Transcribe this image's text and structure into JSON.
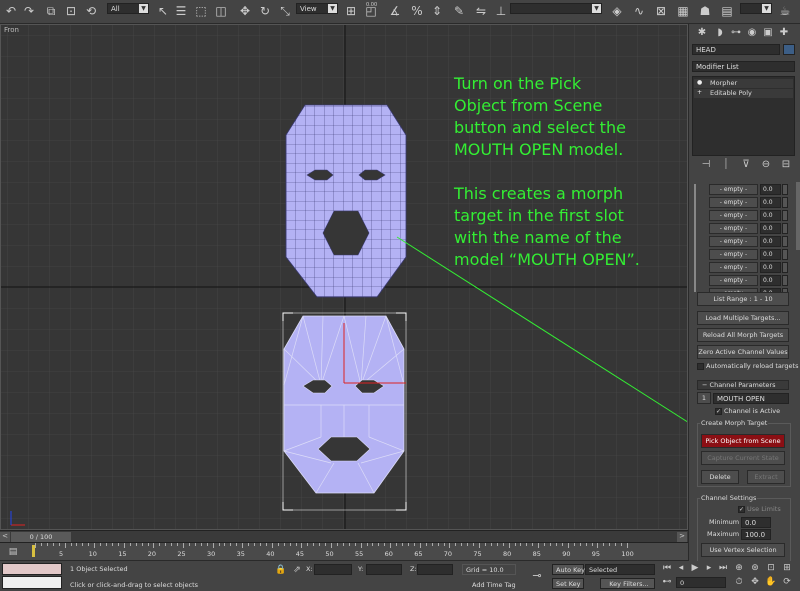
{
  "toolbar": {
    "selection_filter": "All",
    "ref_coord": "View",
    "snap_value": "0.00",
    "named_sel": ""
  },
  "viewport": {
    "label": "Fron",
    "annotation_lines": [
      "Turn on the  Pick",
      "Object from Scene",
      "button and select the",
      "MOUTH OPEN model.",
      "",
      "This creates a morph",
      "target in the first slot",
      "with the name of the",
      "model “MOUTH OPEN”."
    ],
    "annotation_color": "#33ee33"
  },
  "command_panel": {
    "object_name": "HEAD",
    "modifier_list": "Modifier List",
    "stack": [
      "Morpher",
      "Editable Poly"
    ],
    "channels": [
      {
        "name": "- empty -",
        "value": "0.0"
      },
      {
        "name": "- empty -",
        "value": "0.0"
      },
      {
        "name": "- empty -",
        "value": "0.0"
      },
      {
        "name": "- empty -",
        "value": "0.0"
      },
      {
        "name": "- empty -",
        "value": "0.0"
      },
      {
        "name": "- empty -",
        "value": "0.0"
      },
      {
        "name": "- empty -",
        "value": "0.0"
      },
      {
        "name": "- empty -",
        "value": "0.0"
      },
      {
        "name": "- empty -",
        "value": "0.0"
      }
    ],
    "list_range": "List Range :   1 - 10",
    "load_multiple": "Load Multiple Targets...",
    "reload_all": "Reload All Morph Targets",
    "zero_active": "Zero Active Channel Values",
    "auto_reload": "Automatically reload targets",
    "channel_params": "Channel Parameters",
    "channel_number": "1",
    "channel_name": "MOUTH OPEN",
    "channel_active": "Channel is Active",
    "create_target": "Create Morph Target",
    "pick_object": "Pick Object from Scene",
    "capture_state": "Capture Current State",
    "delete": "Delete",
    "extract": "Extract",
    "channel_settings": "Channel Settings",
    "use_limits": "Use Limits",
    "minimum_label": "Minimum :",
    "minimum_value": "0.0",
    "maximum_label": "Maximum :",
    "maximum_value": "100.0",
    "use_vertex_sel": "Use Vertex Selection"
  },
  "timeline": {
    "frame": "0 / 100",
    "ticks": [
      "5",
      "10",
      "15",
      "20",
      "25",
      "30",
      "35",
      "40",
      "45",
      "50",
      "55",
      "60",
      "65",
      "70",
      "75",
      "80",
      "85",
      "90",
      "95",
      "100"
    ]
  },
  "status": {
    "selected": "1 Object Selected",
    "prompt": "Click or click-and-drag to select objects",
    "x_label": "X:",
    "y_label": "Y:",
    "z_label": "Z:",
    "grid": "Grid = 10.0",
    "add_time_tag": "Add Time Tag",
    "auto_key": "Auto Key",
    "selected_mode": "Selected",
    "set_key": "Set Key",
    "key_filters": "Key Filters...",
    "frame_field": "0"
  },
  "colors": {
    "mesh_fill": "#b4b2f4",
    "mesh_line": "#3a3a72",
    "pick_button": "#8b0f14",
    "viewport_bg": "#363636"
  }
}
